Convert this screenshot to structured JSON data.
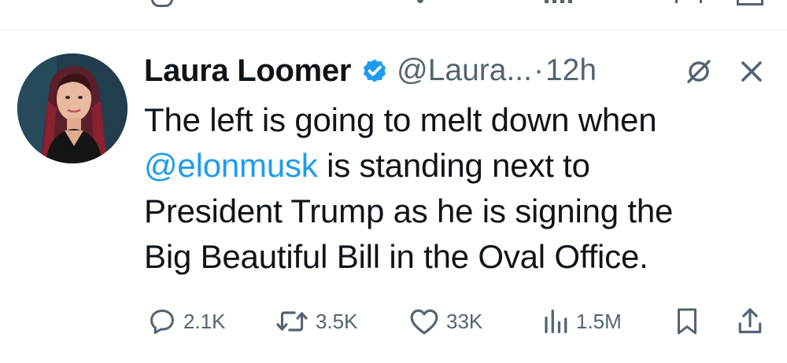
{
  "tweet": {
    "author_name": "Laura Loomer",
    "handle": "@Laura...",
    "separator": "·",
    "time": "12h",
    "text_lines": [
      {
        "before": "The left is going to melt down when",
        "mention": "",
        "after": ""
      },
      {
        "before": "",
        "mention": "@elonmusk",
        "after": " is standing next to"
      },
      {
        "before": "President Trump as he is signing the",
        "mention": "",
        "after": ""
      },
      {
        "before": "Big Beautiful Bill in the Oval Office.",
        "mention": "",
        "after": ""
      }
    ]
  },
  "actions": {
    "replies": "2.1K",
    "reposts": "3.5K",
    "likes": "33K",
    "views": "1.5M"
  },
  "icons": {
    "verified": "verified-badge-icon",
    "mute": "mute-icon",
    "close": "close-icon",
    "reply": "reply-icon",
    "repost": "repost-icon",
    "like": "heart-icon",
    "views": "views-icon",
    "bookmark": "bookmark-icon",
    "share": "share-icon"
  },
  "colors": {
    "text": "#0f1419",
    "secondary": "#536471",
    "link": "#1d9bf0",
    "verified": "#1d9bf0"
  }
}
